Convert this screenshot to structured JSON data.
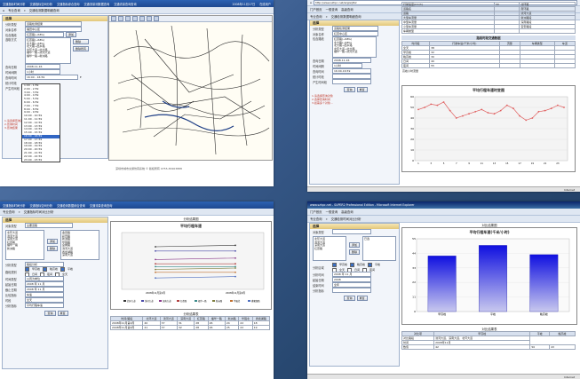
{
  "top_left": {
    "nav_tabs": [
      "交通指标时间分析",
      "交通指标空间分析",
      "交通指标综合查询",
      "交通流量测数据查询",
      "交通流量查询查询"
    ],
    "date": "2008年11月17日",
    "status": "在线用户",
    "crumbs": [
      "专业查询",
      "交通检测数据明细查询"
    ],
    "panel_title": "选择",
    "form": [
      {
        "label": "分析类型",
        "value": "道路检测结果"
      },
      {
        "label": "对象名称",
        "value": "福田中心区"
      },
      {
        "label": "包含路段",
        "value": "红荔路(→SEG)"
      },
      {
        "label": "选取方式",
        "value": "红荔路→SEG"
      }
    ],
    "road_list": [
      "红荔路(→SEG)",
      "北大路(→SEG)",
      "北大路→西乡路",
      "北环大道→北大路",
      "福华一路→滨河大道",
      "福华一路→新洲路",
      "华强路→新洲路"
    ],
    "add_btn": "添加",
    "delete_btn": "删除",
    "clear_btn": "删除所有",
    "query_date": {
      "label": "查询日期",
      "value": "2008-11-16"
    },
    "time_period": {
      "label": "时间间隔",
      "value": "1小时"
    },
    "time_range": {
      "label": "查询时间",
      "value": "16:00 - 16:59"
    },
    "period_label": "统计时段",
    "output_label": "产生时间段",
    "dropdown": [
      "1:00 - 1:59",
      "2:00 - 2:59",
      "3:00 - 3:59",
      "4:00 - 4:59",
      "5:00 - 5:59",
      "6:00 - 6:59",
      "7:00 - 7:59",
      "8:00 - 8:59",
      "9:00 - 9:59",
      "10:00 - 10:59",
      "11:00 - 11:59",
      "12:00 - 12:59",
      "13:00 - 13:59",
      "14:00 - 14:59",
      "15:00 - 15:59",
      "16:00 - 16:59",
      "17:00 - 17:59",
      "18:00 - 18:59",
      "19:00 - 19:59",
      "20:00 - 20:59",
      "21:00 - 21:59",
      "22:00 - 22:59",
      "23:00 - 23:59"
    ],
    "dropdown_selected": 15,
    "notes": [
      "1.请选择查询对象",
      "2.查询时间",
      "3.查询结果"
    ],
    "footer": "深圳市城市交通仿真系统 © 版权所有 0755-83463888"
  },
  "top_right": {
    "address": "http://www.szhpc.net/szgis/jtbz",
    "nav": [
      "门户首页",
      "一般查询",
      "高级查询"
    ],
    "crumbs": [
      "专业查询",
      "交通检测数据明细查询"
    ],
    "panel_title": "选择",
    "form": [
      {
        "label": "分析类型",
        "value": "道路检测结果"
      },
      {
        "label": "对象名称",
        "value": "红荔中心区"
      },
      {
        "label": "包含路段",
        "value": "红荔路(→SEG)"
      },
      {
        "label": "查询日期",
        "value": "2008-11-16"
      },
      {
        "label": "时间间隔",
        "value": "1小时"
      },
      {
        "label": "查询时间",
        "value": "16:00-16:59"
      },
      {
        "label": "统计时段",
        "value": ""
      },
      {
        "label": "产生时间段",
        "value": ""
      }
    ],
    "road_list": [
      "红荔路(→SEG)",
      "北大路(→SEG)",
      "北大路→西乡路",
      "北环大道→北大路",
      "福华一路→滨河大道"
    ],
    "buttons": [
      "查询",
      "重置"
    ],
    "notes": [
      "1.请选择查询对象",
      "2.选择查询时间",
      "3.如需多个对象..."
    ],
    "table_top": [
      [
        "行驶速度(km/h)",
        "30",
        "北环路"
      ],
      [
        "道路名",
        "",
        "南环路"
      ],
      [
        "道路",
        "",
        "滨河大道"
      ],
      [
        "大型车流量",
        "",
        "新洲路段"
      ],
      [
        "中型车流量",
        "",
        "深南路段"
      ],
      [
        "小型车流量",
        "",
        "宝安路段"
      ],
      [
        "车辆类型",
        "",
        ""
      ]
    ],
    "table2_title": "路段时段交通数据",
    "table2_head": [
      "时间段",
      "行驶车速(千米/小时)",
      "流量",
      "车辆类型",
      "车道"
    ],
    "table2_rows": [
      [
        "全天",
        "38",
        "",
        "",
        ""
      ],
      [
        "早高峰",
        "32",
        "",
        "",
        ""
      ],
      [
        "晚高峰",
        "30",
        "",
        "",
        ""
      ],
      [
        "日间",
        "40",
        "",
        "",
        ""
      ],
      [
        "夜间",
        "55",
        "",
        "",
        ""
      ]
    ],
    "table2_note": "高峰小时流量",
    "status": "Internet",
    "chart_data": {
      "type": "line",
      "title": "平均行程车速时变图",
      "x": [
        1,
        2,
        3,
        4,
        5,
        6,
        7,
        8,
        9,
        10,
        11,
        12,
        13,
        14,
        15,
        16,
        17,
        18,
        19,
        20,
        21,
        22,
        23,
        24
      ],
      "values": [
        48,
        50,
        53,
        52,
        55,
        47,
        40,
        42,
        44,
        46,
        48,
        45,
        44,
        47,
        52,
        49,
        42,
        38,
        40,
        46,
        47,
        49,
        52,
        50
      ],
      "ylim": [
        0,
        60
      ]
    }
  },
  "bottom_left": {
    "nav_tabs": [
      "交通指标时间分析",
      "交通指标空间分析",
      "交通检测数据综合查询",
      "交通流量查询查询"
    ],
    "crumbs": [
      "专业查询",
      "交通指标时间对比分析"
    ],
    "panel_title": "选择",
    "object_label": "对象类型",
    "object_value": "主要道路",
    "left_list": [
      "北环大道",
      "滨河大道",
      "深南大道",
      "红荔路",
      "福华一路",
      "新洲路"
    ],
    "right_list": [
      "金田路",
      "彩田路",
      "新洲路",
      "华强路",
      "皇岗路",
      "滨河大道",
      "香蜜湖路",
      "深南大道"
    ],
    "add_btn": "添加",
    "delete_btn": "删除",
    "form": [
      {
        "label": "分析类型",
        "value": "路段分析"
      },
      {
        "label": "路段类别",
        "value": ""
      },
      {
        "label": "时间类型",
        "value": "以周为单位"
      },
      {
        "label": "起始日期",
        "value": "2008 年 11 月"
      },
      {
        "label": "截止日期",
        "value": "2008 年 11 月"
      },
      {
        "label": "比较指标",
        "value": "车速"
      },
      {
        "label": "时段",
        "value": "全天"
      },
      {
        "label": "分析指标",
        "value": "平均行程车速"
      }
    ],
    "checkboxes": [
      "早高峰",
      "晚高峰",
      "平峰",
      "日间",
      "夜间",
      "全天"
    ],
    "buttons": [
      "查询",
      "重置"
    ],
    "result_title": "分析结果图",
    "chart_data": {
      "type": "line",
      "title": "平均行程车速",
      "categories": [
        "2008年11月第1周",
        "2008年11月第2周"
      ],
      "series": [
        {
          "name": "北环大道",
          "values": [
            40,
            41
          ]
        },
        {
          "name": "滨河大道",
          "values": [
            37,
            37
          ]
        },
        {
          "name": "深南大道",
          "values": [
            31,
            32
          ]
        },
        {
          "name": "红荔路",
          "values": [
            28,
            28
          ]
        },
        {
          "name": "福华一路",
          "values": [
            26,
            26
          ]
        },
        {
          "name": "新洲路",
          "values": [
            24,
            25
          ]
        },
        {
          "name": "华强北",
          "values": [
            22,
            22
          ]
        },
        {
          "name": "香蜜湖路",
          "values": [
            18,
            19
          ]
        }
      ]
    },
    "table_title": "分析结果表",
    "table_head": [
      "时间/路段",
      "北环大道",
      "滨河大道",
      "深南大道",
      "红荔路",
      "福华一路",
      "新洲路",
      "华强北",
      "香蜜湖路"
    ],
    "table_rows": [
      [
        "2008年11月第1周",
        "40",
        "37",
        "31",
        "28",
        "26",
        "24",
        "22",
        "18"
      ],
      [
        "2008年11月第2周",
        "41",
        "37",
        "32",
        "28",
        "26",
        "25",
        "22",
        "19"
      ]
    ]
  },
  "bottom_right": {
    "window_title": "www.szhpc.net - SUPER2 Professional Edition - Microsoft Internet Explorer",
    "nav": [
      "门户首页",
      "一般查询",
      "高级查询"
    ],
    "crumbs": [
      "专业查询",
      "交通检测时间对比分析"
    ],
    "panel_title": "选择",
    "object_label": "对象类型",
    "left_list": [
      "北环大道",
      "滨河大道",
      "深南大道",
      "红荔路"
    ],
    "right_list": [
      "已选"
    ],
    "add_btn": "添加",
    "delete_btn": "删除",
    "checkboxes": [
      "早高峰",
      "晚高峰",
      "平峰",
      "全天",
      "日间",
      "夜间"
    ],
    "form": [
      {
        "label": "分析区域",
        "value": ""
      },
      {
        "label": "分析时间",
        "value": "2008 年 11 月"
      },
      {
        "label": "起始日期",
        "value": "2008"
      },
      {
        "label": "结束时间",
        "value": "全年"
      },
      {
        "label": "分析指标",
        "value": ""
      }
    ],
    "buttons": [
      "查询",
      "重置"
    ],
    "result_title": "对比结果图",
    "chart_data": {
      "type": "bar",
      "title": "平均行程车速(千米/小时)",
      "categories": [
        "早高峰",
        "平峰",
        "晚高峰"
      ],
      "values": [
        42,
        50,
        43
      ],
      "ylim": [
        0,
        55
      ]
    },
    "table_title": "对比结果表",
    "table_head": [
      "对比项",
      "早高峰",
      "平峰",
      "晚高峰"
    ],
    "table_rows": [
      [
        "对比路段",
        "滨河大道、深南大道、北环大道"
      ],
      [
        "时间",
        "2008年11月"
      ],
      [
        "数值",
        "42",
        "50",
        "43"
      ]
    ],
    "status": "Internet"
  }
}
